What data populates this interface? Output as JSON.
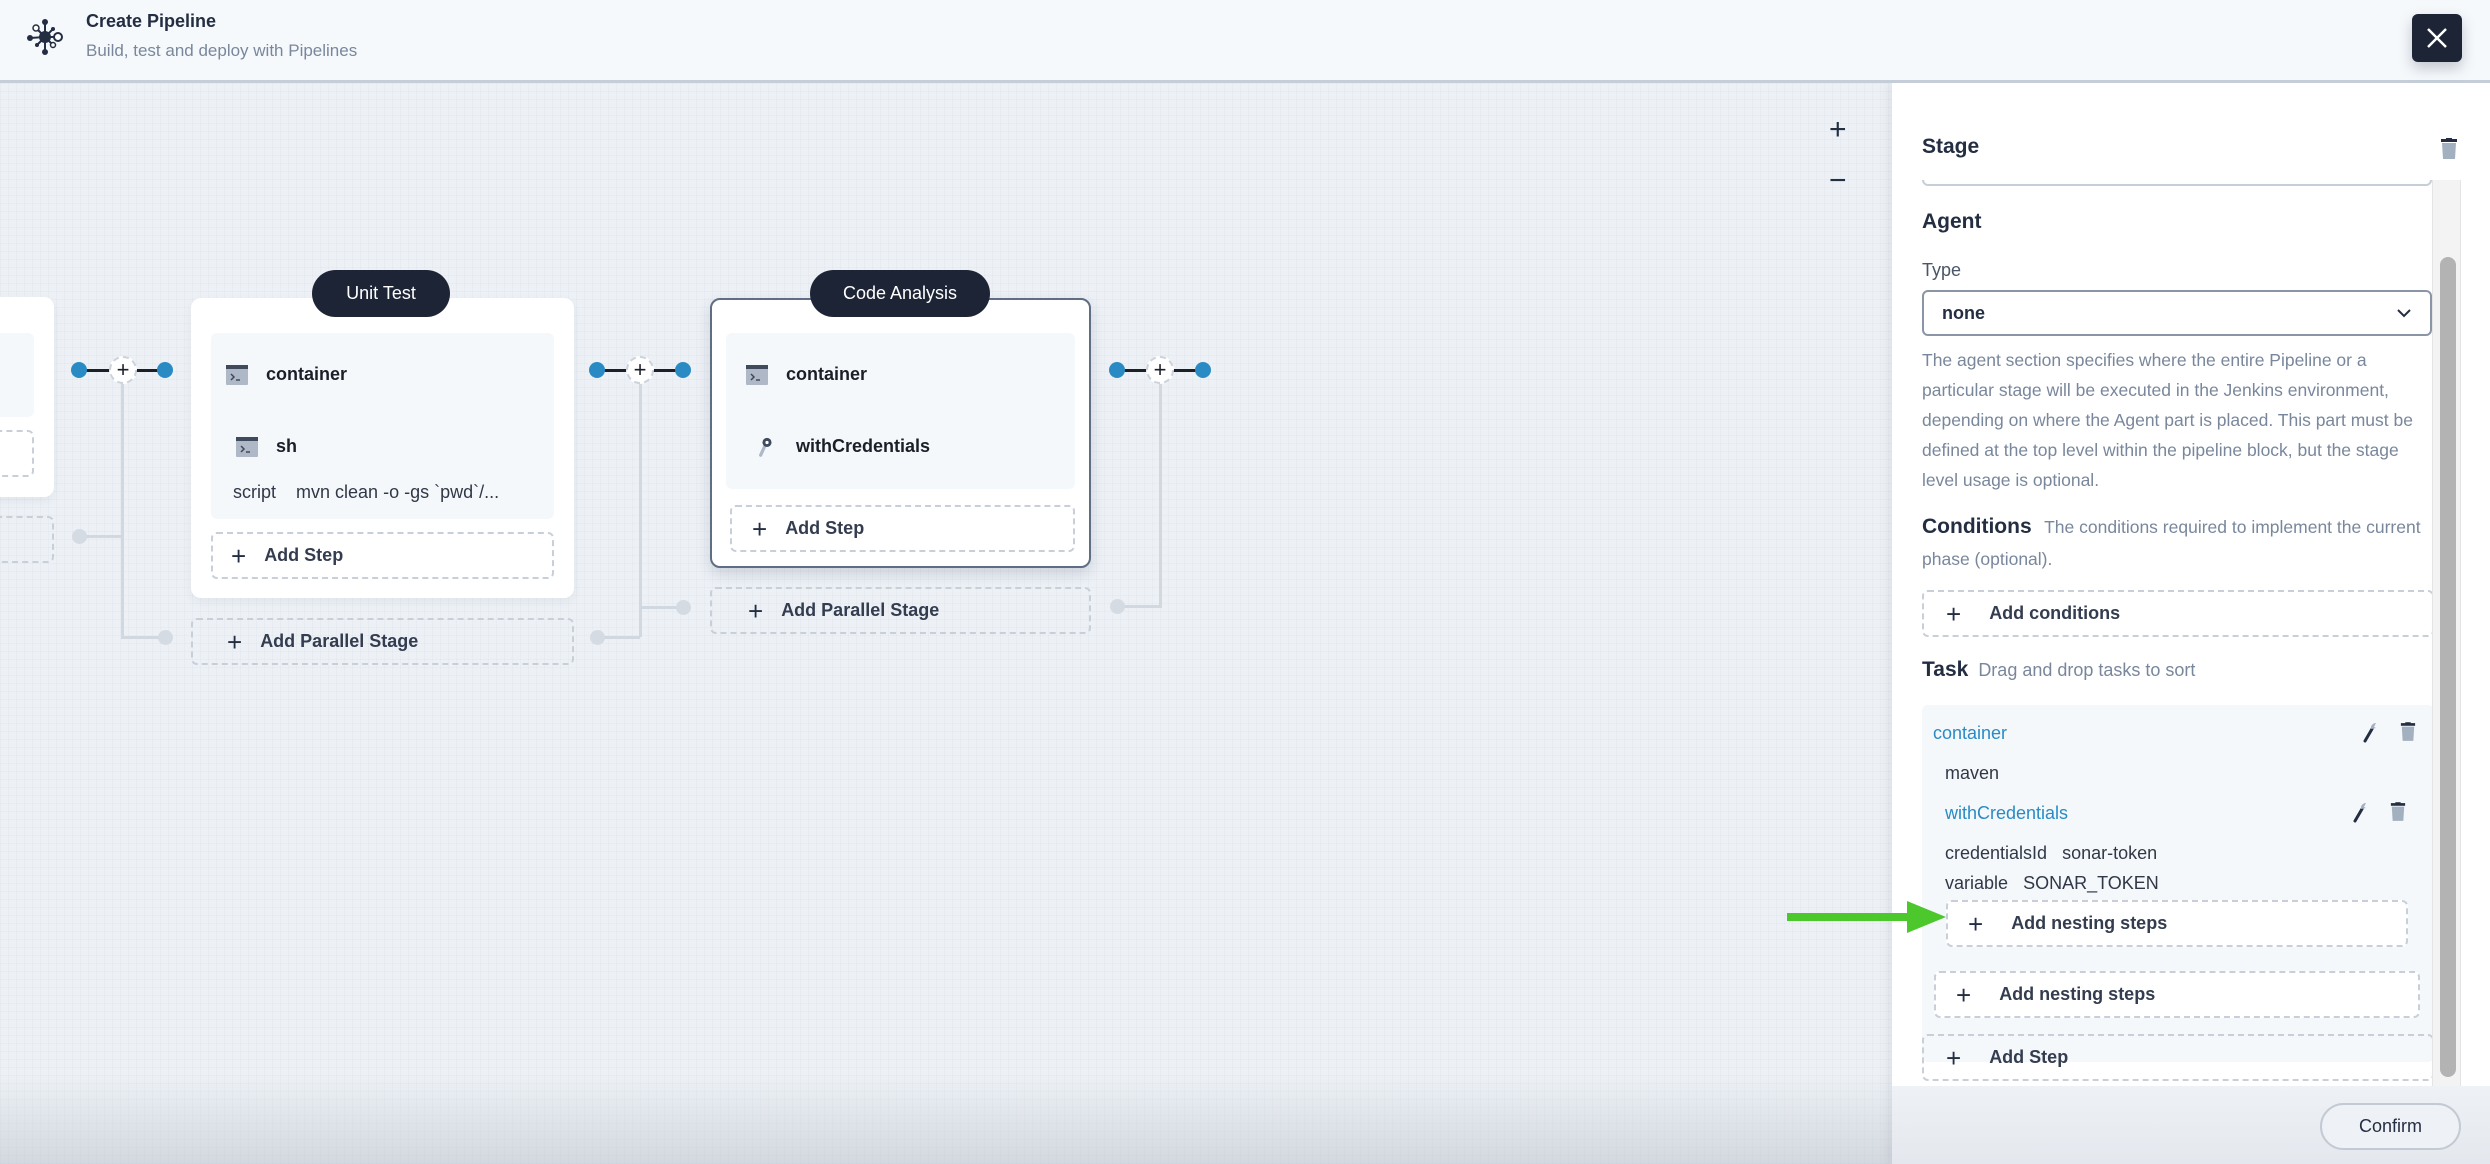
{
  "header": {
    "title": "Create Pipeline",
    "subtitle": "Build, test and deploy with Pipelines",
    "logo_icon": "pipeline-network-icon",
    "close_icon": "close-icon"
  },
  "canvas": {
    "zoom_in": "+",
    "zoom_out": "−",
    "stages": [
      {
        "name": "",
        "partial": true,
        "add_parallel_label": ""
      },
      {
        "name": "Unit Test",
        "steps": [
          {
            "icon": "terminal-icon",
            "name": "container"
          },
          {
            "icon": "terminal-icon",
            "name": "sh",
            "meta_key": "script",
            "meta_value": "mvn clean -o -gs `pwd`/..."
          }
        ],
        "add_step_label": "Add Step",
        "add_parallel_label": "Add Parallel Stage"
      },
      {
        "name": "Code Analysis",
        "selected": true,
        "steps": [
          {
            "icon": "terminal-icon",
            "name": "container"
          },
          {
            "icon": "key-icon",
            "name": "withCredentials"
          }
        ],
        "add_step_label": "Add Step",
        "add_parallel_label": "Add Parallel Stage"
      }
    ],
    "plus_symbol": "+"
  },
  "panel": {
    "title": "Stage",
    "agent": {
      "title": "Agent",
      "type_label": "Type",
      "type_value": "none",
      "description": "The agent section specifies where the entire Pipeline or a particular stage will be executed in the Jenkins environment, depending on where the Agent part is placed. This part must be defined at the top level within the pipeline block, but the stage level usage is optional."
    },
    "conditions": {
      "title": "Conditions",
      "note": "The conditions required to implement the current phase (optional).",
      "add_label": "Add conditions"
    },
    "task": {
      "title": "Task",
      "note": "Drag and drop tasks to sort",
      "items": [
        {
          "name": "container",
          "value": "maven",
          "children": [
            {
              "name": "withCredentials",
              "params": [
                {
                  "key": "credentialsId",
                  "value": "sonar-token"
                },
                {
                  "key": "variable",
                  "value": "SONAR_TOKEN"
                }
              ],
              "add_nested_label": "Add nesting steps"
            }
          ],
          "add_nested_label": "Add nesting steps"
        }
      ],
      "add_step_label": "Add Step"
    },
    "confirm_label": "Confirm"
  },
  "annotation": {
    "arrow_color": "#4cc72c",
    "points_to": "Add nesting steps"
  },
  "colors": {
    "accent_blue": "#2a8bc4",
    "dark": "#1d2435"
  }
}
